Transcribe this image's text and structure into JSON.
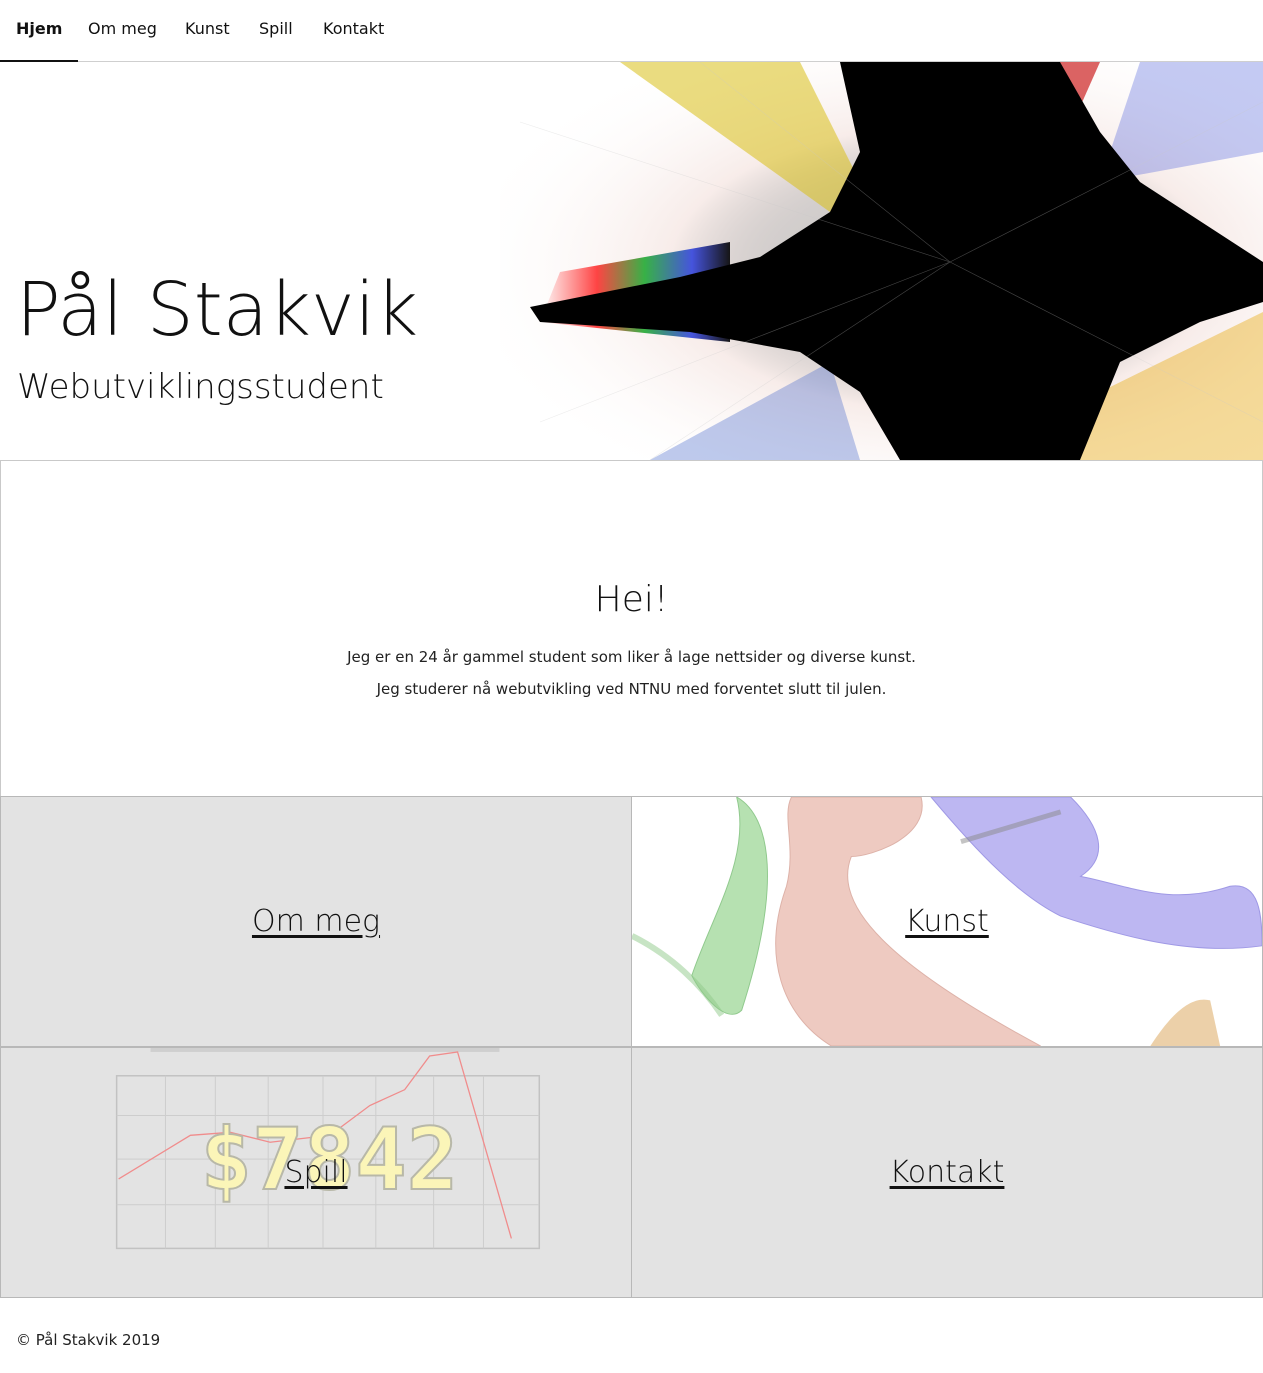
{
  "nav": {
    "items": [
      {
        "label": "Hjem",
        "active": true
      },
      {
        "label": "Om meg",
        "active": false
      },
      {
        "label": "Kunst",
        "active": false
      },
      {
        "label": "Spill",
        "active": false
      },
      {
        "label": "Kontakt",
        "active": false
      }
    ]
  },
  "hero": {
    "title": "Pål Stakvik",
    "subtitle": "Webutviklingsstudent"
  },
  "intro": {
    "heading": "Hei!",
    "line1": "Jeg er en 24 år gammel student som liker å lage nettsider og diverse kunst.",
    "line2": "Jeg studerer nå webutvikling ved NTNU med forventet slutt til julen."
  },
  "tiles": {
    "om_meg": "Om meg",
    "kunst": "Kunst",
    "spill": "Spill",
    "kontakt": "Kontakt"
  },
  "spill_art": {
    "money": "$7842"
  },
  "footer": {
    "copyright": "© Pål Stakvik 2019"
  },
  "colors": {
    "tile_gray": "#e3e3e3",
    "border": "#b8b8b8",
    "text": "#111111"
  }
}
